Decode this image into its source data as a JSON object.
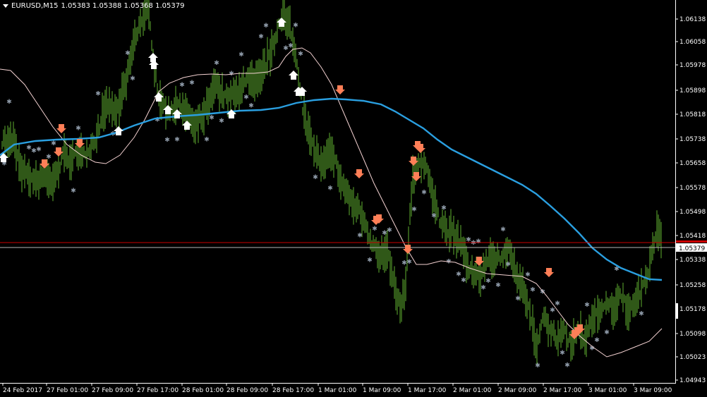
{
  "header": {
    "symbol_timeframe": "EURUSD,M15",
    "ohlc": "1.05383 1.05388 1.05368 1.05379"
  },
  "price_scale": {
    "labels": [
      "1.06138",
      "1.06058",
      "1.05978",
      "1.05898",
      "1.05818",
      "1.05738",
      "1.05658",
      "1.05578",
      "1.05498",
      "1.05418",
      "1.05338",
      "1.05258",
      "1.05178",
      "1.05098",
      "1.05023",
      "1.04943"
    ],
    "current_price": "1.05379"
  },
  "time_scale": {
    "labels": [
      "24 Feb 2017",
      "27 Feb 01:00",
      "27 Feb 09:00",
      "27 Feb 17:00",
      "28 Feb 01:00",
      "28 Feb 09:00",
      "28 Feb 17:00",
      "1 Mar 01:00",
      "1 Mar 09:00",
      "1 Mar 17:00",
      "2 Mar 01:00",
      "2 Mar 09:00",
      "2 Mar 17:00",
      "3 Mar 01:00",
      "3 Mar 09:00"
    ]
  },
  "colors": {
    "background": "#000000",
    "bars": "#5fb030",
    "moving_average": "#2a9fe0",
    "envelope": "#f4d2d2",
    "stars": "#8e9aa8",
    "sell_arrow": "#ff7f57",
    "buy_arrow": "#ffffff",
    "bid_line": "#cc0000",
    "current_line": "#b8b8b8",
    "axis_text": "#ffffff"
  }
}
